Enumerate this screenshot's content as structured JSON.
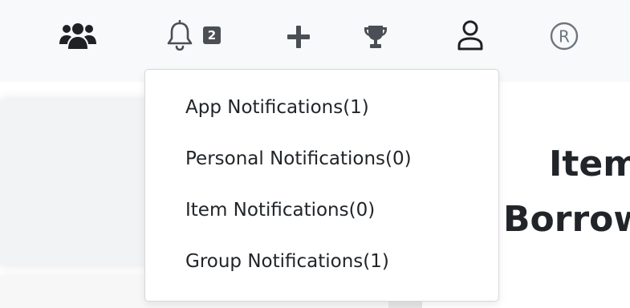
{
  "navbar": {
    "icons": [
      {
        "name": "users-icon"
      },
      {
        "name": "bell-icon"
      },
      {
        "name": "plus-icon"
      },
      {
        "name": "trophy-icon"
      },
      {
        "name": "user-icon"
      },
      {
        "name": "registered-icon"
      }
    ],
    "notification_count": "2",
    "registered_symbol": "®"
  },
  "notifications_dropdown": {
    "items": [
      {
        "label": "App Notifications(1)"
      },
      {
        "label": "Personal Notifications(0)"
      },
      {
        "label": "Item Notifications(0)"
      },
      {
        "label": "Group Notifications(1)"
      }
    ]
  },
  "main": {
    "heading_line1": "Item",
    "heading_line2": "Borrow"
  },
  "colors": {
    "navbar_bg": "#f8f9fa",
    "icon_color": "#4a4f55",
    "badge_bg": "#4a4f55",
    "text": "#212529"
  }
}
